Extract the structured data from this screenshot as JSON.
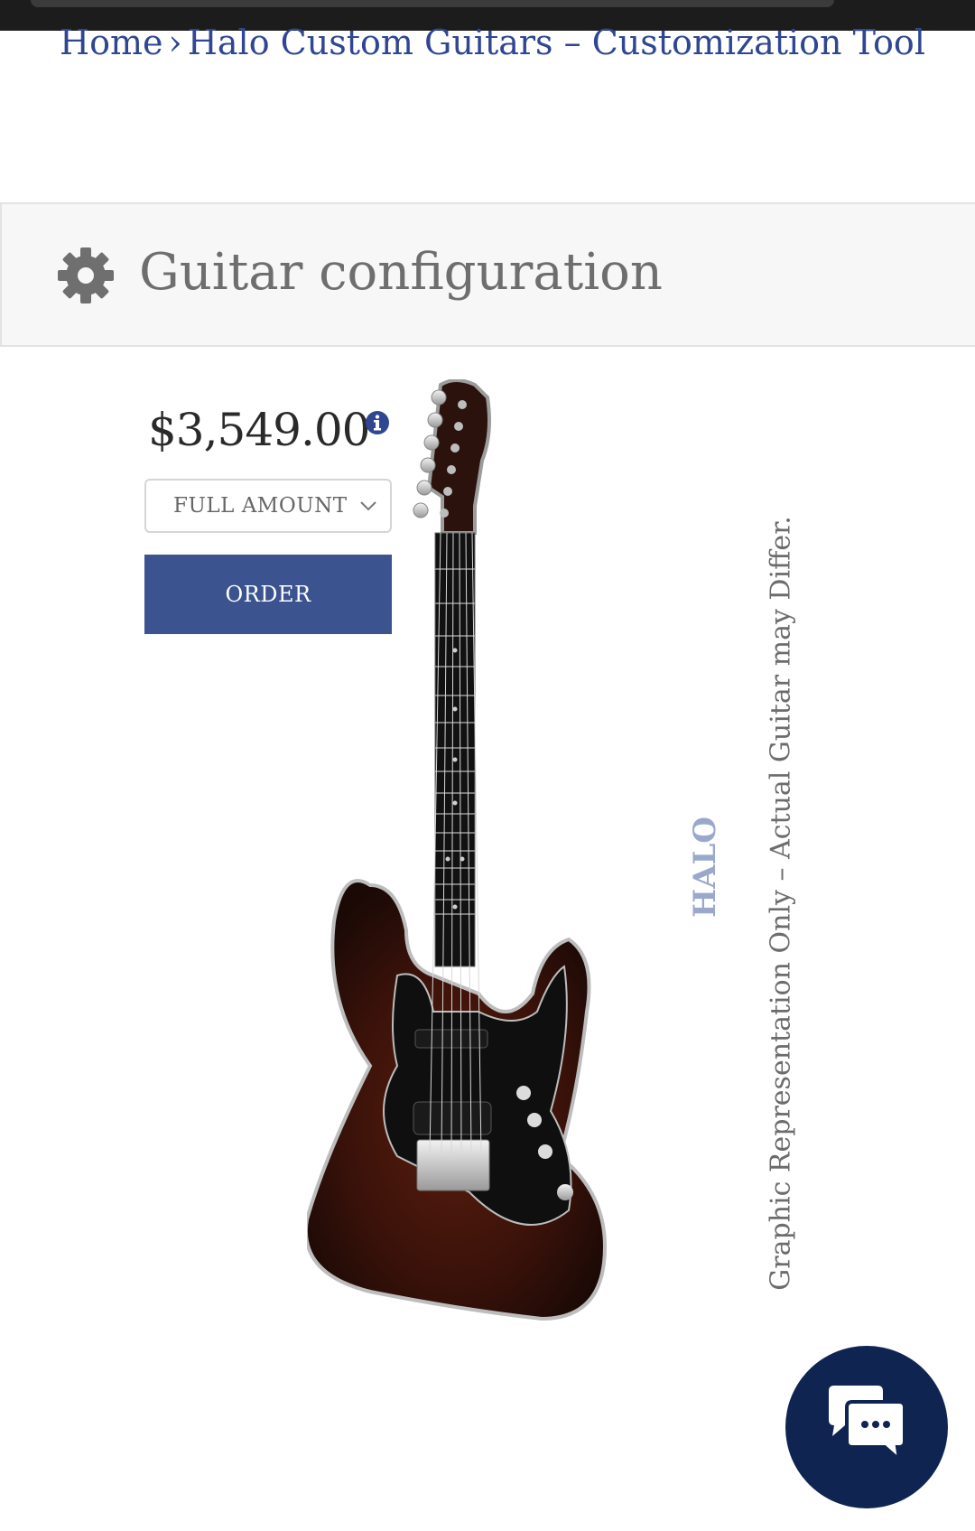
{
  "breadcrumb": {
    "home": "Home",
    "separator": "›",
    "current": "Halo Custom Guitars – Customization Tool"
  },
  "section": {
    "title": "Guitar configuration",
    "icon": "gear-icon"
  },
  "product": {
    "price": "$3,549.00",
    "payment_option": {
      "selected": "FULL AMOUNT"
    },
    "order_label": "ORDER"
  },
  "preview": {
    "disclaimer": "Graphic Representation Only – Actual Guitar may Differ.",
    "watermark_text": "HALO"
  },
  "colors": {
    "link": "#2f4693",
    "order_button": "#3b538f",
    "chat_button": "#0f2450",
    "header_bg": "#f7f7f7"
  }
}
